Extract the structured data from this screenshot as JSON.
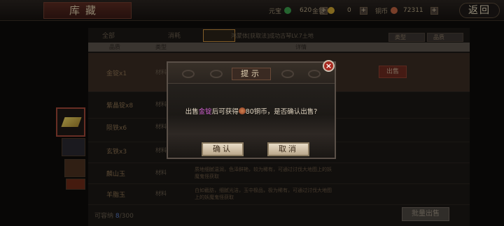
{
  "header": {
    "title": "库藏",
    "back_label": "返回",
    "currencies": [
      {
        "name": "元宝",
        "value": "620",
        "icon": "green-gem-icon",
        "color": "#3a9a4a"
      },
      {
        "name": "金锭",
        "value": "0",
        "icon": "gold-coin-icon",
        "color": "#c8a030"
      },
      {
        "name": "铜币",
        "value": "72311",
        "icon": "copper-coin-icon",
        "color": "#b86040"
      }
    ],
    "plus": "+"
  },
  "background": {
    "tabs": [
      "全部",
      "消耗"
    ],
    "info": "鸿蒙体[获取法]成功古琴LV.7土地",
    "dropdowns": [
      "类型",
      "品质"
    ],
    "columns": [
      "品质",
      "类型",
      "详情"
    ],
    "rows": [
      {
        "name": "金锭x1",
        "type": "材料",
        "desc": ""
      },
      {
        "name": "紫晶锭x8",
        "type": "材料",
        "desc": ""
      },
      {
        "name": "陨铁x6",
        "type": "材料",
        "desc": ""
      },
      {
        "name": "玄铁x3",
        "type": "材料",
        "desc": ""
      },
      {
        "name": "麟山玉",
        "type": "材料",
        "desc": "质地细腻温润，色泽鲜艳，较为稀有，可通过讨伐大地图上的妖魔鬼怪获取"
      },
      {
        "name": "羊脂玉",
        "type": "材料",
        "desc": "白如截肪，细腻光洁，玉中极品，极为稀有，可通过讨伐大地图上的妖魔鬼怪获取"
      }
    ],
    "sell_label": "出售",
    "batch_sell_label": "批量出售",
    "capacity_label": "可容纳",
    "capacity_used": "8",
    "capacity_total": "/300"
  },
  "dialog": {
    "title": "提示",
    "close": "×",
    "msg_prefix": "出售",
    "msg_item": "金锭",
    "msg_mid": "后可获得",
    "msg_amount": "80",
    "msg_suffix": "铜币，是否确认出售?",
    "confirm_label": "确认",
    "cancel_label": "取消"
  }
}
